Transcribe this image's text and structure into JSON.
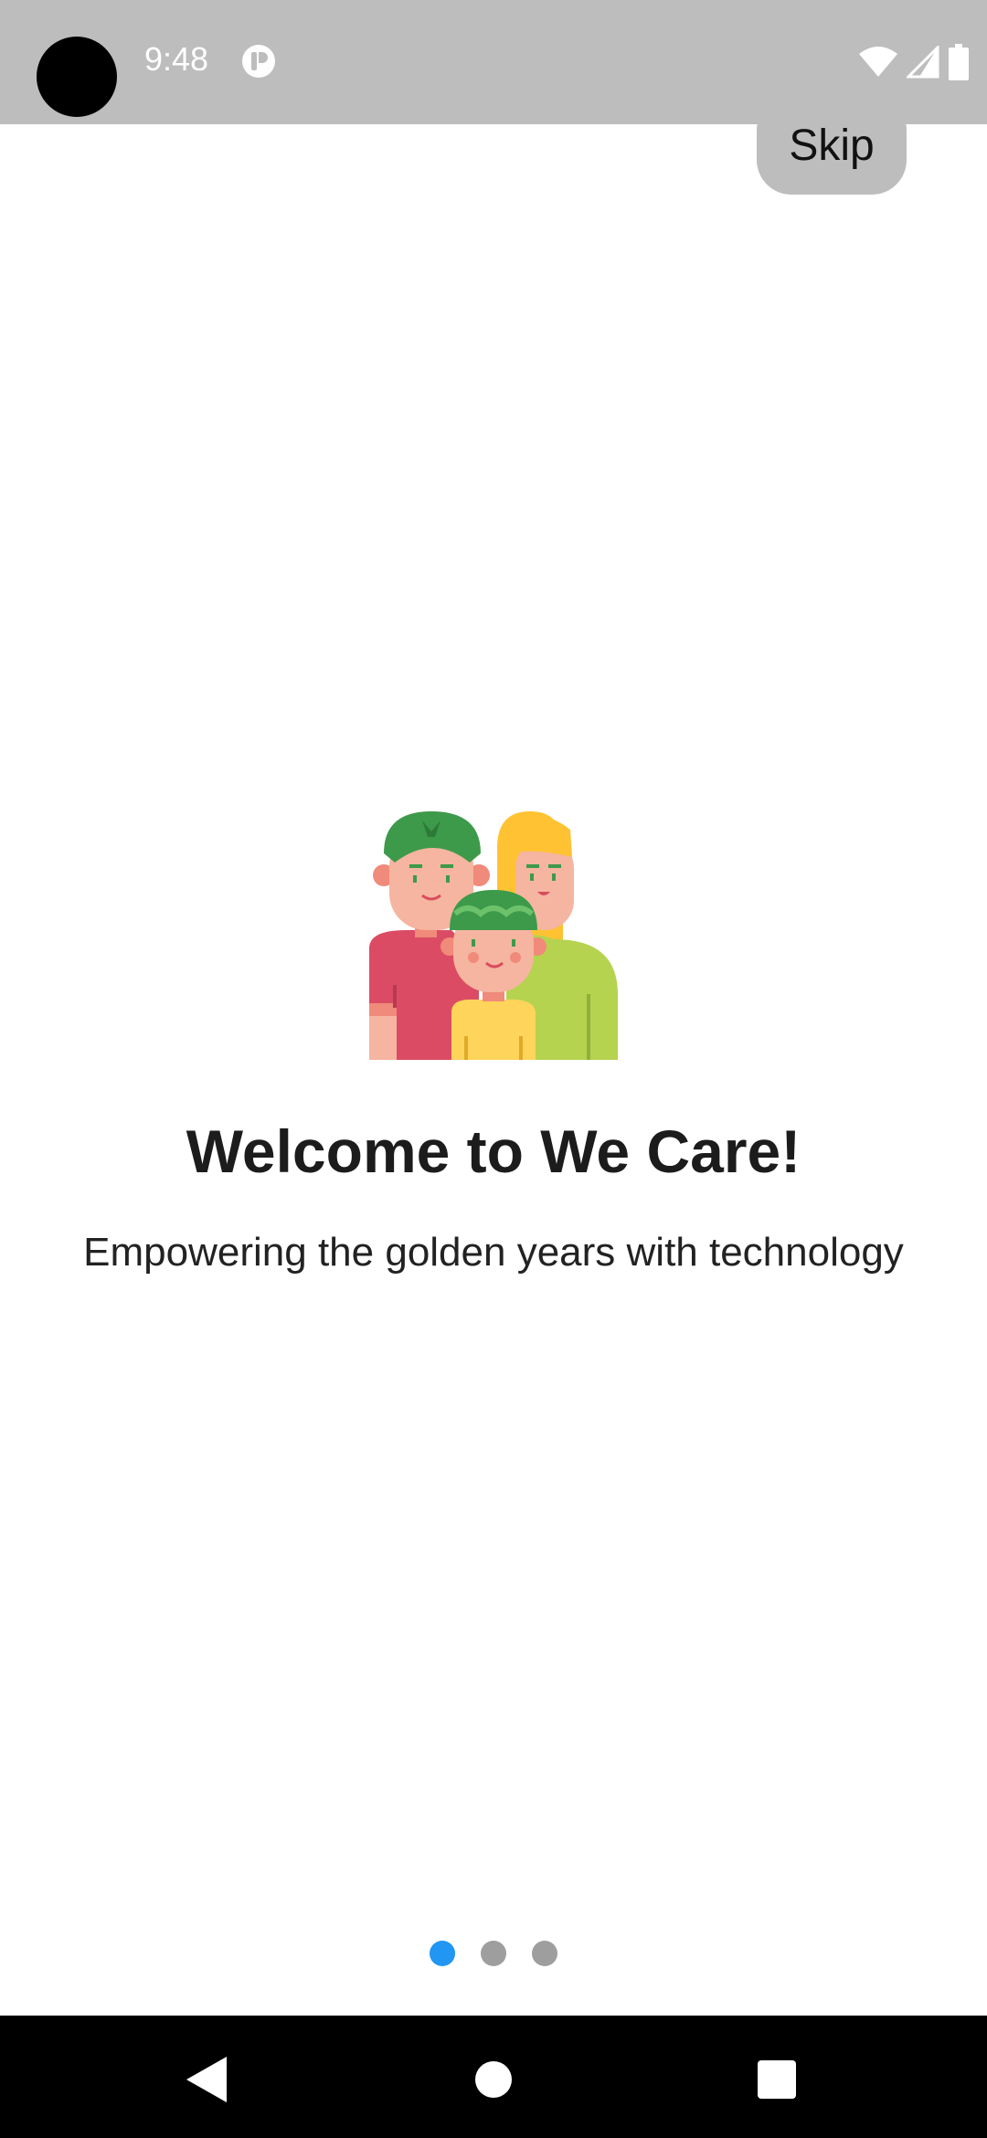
{
  "status_bar": {
    "time": "9:48"
  },
  "skip_label": "Skip",
  "onboarding": {
    "title": "Welcome to We Care!",
    "subtitle": "Empowering the golden years with technology",
    "pages_total": 3,
    "current_page": 1
  },
  "colors": {
    "status_bar_bg": "#bdbdbd",
    "skip_bg": "#bdbdbd",
    "active_dot": "#2196f3",
    "inactive_dot": "#9e9e9e",
    "nav_bar_bg": "#000000"
  },
  "icons": {
    "illustration": "family-illustration",
    "status_left": "app-notification-icon",
    "status_right": [
      "wifi-icon",
      "signal-icon",
      "battery-icon"
    ],
    "nav": [
      "back-icon",
      "home-icon",
      "recents-icon"
    ]
  }
}
